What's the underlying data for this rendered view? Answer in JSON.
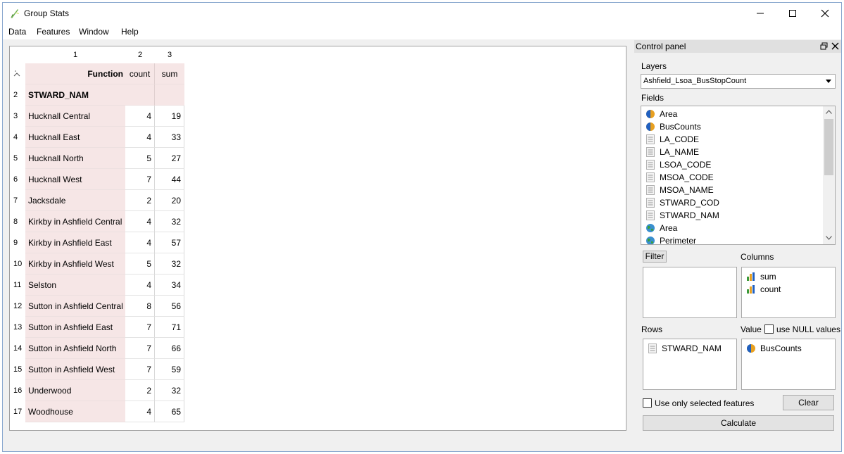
{
  "window": {
    "title": "Group Stats"
  },
  "menu": [
    "Data",
    "Features",
    "Window",
    "Help"
  ],
  "table": {
    "column_numbers": [
      "1",
      "2",
      "3"
    ],
    "header_row": {
      "row_number": "",
      "label": "Function",
      "col2": "count",
      "col3": "sum"
    },
    "group_row": {
      "row_number": "2",
      "label": "STWARD_NAM"
    },
    "rows": [
      {
        "n": "3",
        "name": "Hucknall Central",
        "count": "4",
        "sum": "19"
      },
      {
        "n": "4",
        "name": "Hucknall East",
        "count": "4",
        "sum": "33"
      },
      {
        "n": "5",
        "name": "Hucknall North",
        "count": "5",
        "sum": "27"
      },
      {
        "n": "6",
        "name": "Hucknall West",
        "count": "7",
        "sum": "44"
      },
      {
        "n": "7",
        "name": "Jacksdale",
        "count": "2",
        "sum": "20"
      },
      {
        "n": "8",
        "name": "Kirkby in Ashfield Central",
        "count": "4",
        "sum": "32"
      },
      {
        "n": "9",
        "name": "Kirkby in Ashfield East",
        "count": "4",
        "sum": "57"
      },
      {
        "n": "10",
        "name": "Kirkby in Ashfield West",
        "count": "5",
        "sum": "32"
      },
      {
        "n": "11",
        "name": "Selston",
        "count": "4",
        "sum": "34"
      },
      {
        "n": "12",
        "name": "Sutton in Ashfield Central",
        "count": "8",
        "sum": "56"
      },
      {
        "n": "13",
        "name": "Sutton in Ashfield East",
        "count": "7",
        "sum": "71"
      },
      {
        "n": "14",
        "name": "Sutton in Ashfield North",
        "count": "7",
        "sum": "66"
      },
      {
        "n": "15",
        "name": "Sutton in Ashfield West",
        "count": "7",
        "sum": "59"
      },
      {
        "n": "16",
        "name": "Underwood",
        "count": "2",
        "sum": "32"
      },
      {
        "n": "17",
        "name": "Woodhouse",
        "count": "4",
        "sum": "65"
      }
    ]
  },
  "control_panel": {
    "title": "Control panel",
    "layers_label": "Layers",
    "layer_selected": "Ashfield_Lsoa_BusStopCount",
    "fields_label": "Fields",
    "fields": [
      {
        "name": "Area",
        "icon": "numeric-icon"
      },
      {
        "name": "BusCounts",
        "icon": "numeric-icon"
      },
      {
        "name": "LA_CODE",
        "icon": "text-field-icon"
      },
      {
        "name": "LA_NAME",
        "icon": "text-field-icon"
      },
      {
        "name": "LSOA_CODE",
        "icon": "text-field-icon"
      },
      {
        "name": "MSOA_CODE",
        "icon": "text-field-icon"
      },
      {
        "name": "MSOA_NAME",
        "icon": "text-field-icon"
      },
      {
        "name": "STWARD_COD",
        "icon": "text-field-icon"
      },
      {
        "name": "STWARD_NAM",
        "icon": "text-field-icon"
      },
      {
        "name": "Area",
        "icon": "globe-icon"
      },
      {
        "name": "Perimeter",
        "icon": "globe-icon"
      }
    ],
    "filter_label": "Filter",
    "columns_label": "Columns",
    "columns": [
      "sum",
      "count"
    ],
    "rows_label": "Rows",
    "rows": [
      "STWARD_NAM"
    ],
    "value_label": "Value",
    "use_null_label": "use NULL values",
    "value": [
      "BusCounts"
    ],
    "selected_only_label": "Use only selected features",
    "clear_label": "Clear",
    "calculate_label": "Calculate"
  },
  "colors": {
    "label_cell_bg": "#f6e6e6",
    "numeric_icon": "#e8a020",
    "chart_icon_bars": [
      "#3a9a3a",
      "#e8a020",
      "#2060c0"
    ]
  }
}
